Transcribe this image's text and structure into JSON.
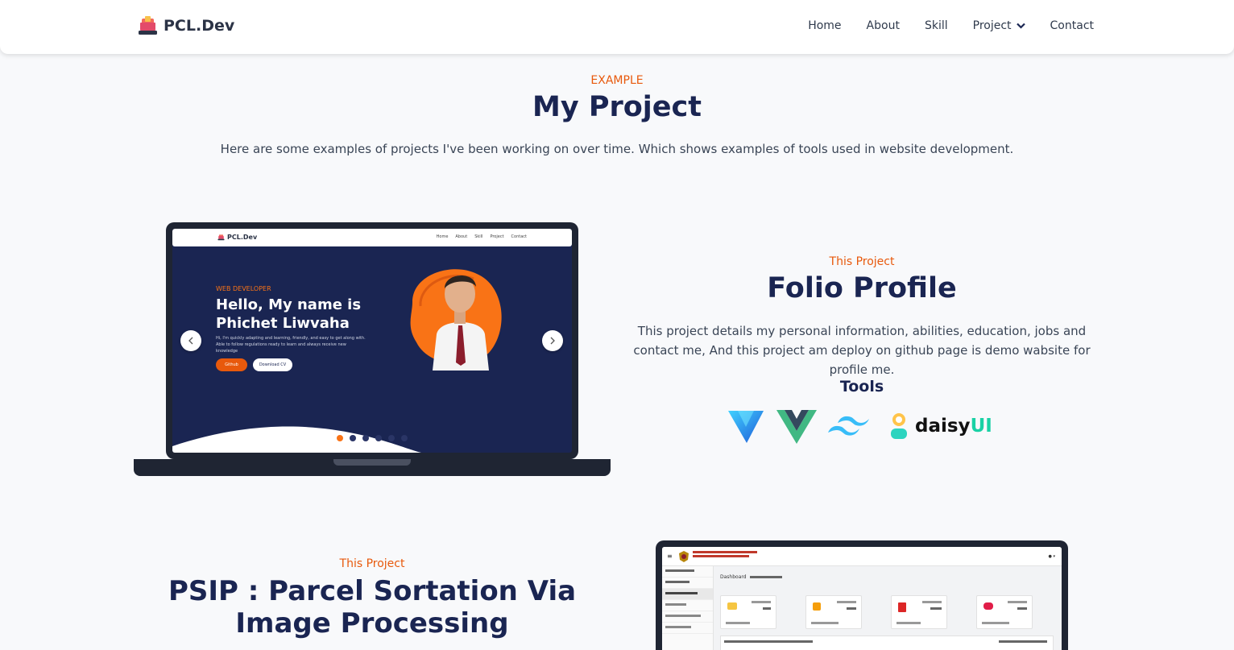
{
  "nav": {
    "brand": "PCL.Dev",
    "links": [
      "Home",
      "About",
      "Skill",
      "Project",
      "Contact"
    ]
  },
  "header": {
    "eyebrow": "EXAMPLE",
    "title": "My Project",
    "intro": "Here are some examples of projects I've been working on over time. Which shows examples of tools used in website development."
  },
  "project1": {
    "eyebrow": "This Project",
    "title": "Folio Profile",
    "description": "This project details my personal information, abilities, education, jobs and contact me, And this project am deploy on github page is demo wabsite for profile me.",
    "tools_heading": "Tools",
    "tools": [
      "vite-icon",
      "vue-icon",
      "tailwind-icon",
      "daisyui-icon"
    ],
    "daisy_label_1": "daisy",
    "daisy_label_2": "UI",
    "preview": {
      "brand": "PCL.Dev",
      "links": [
        "Home",
        "About",
        "Skill",
        "Project",
        "Contact"
      ],
      "eyebrow": "WEB DEVELOPER",
      "title": "Hello, My name is Phichet Liwvaha",
      "description": "Hi, I'm quickly adapting and learning, friendly, and easy to get along with. Able to follow regulations ready to learn and always receive new knowledge",
      "btn_github": "Github",
      "btn_cv": "Download CV"
    }
  },
  "project2": {
    "eyebrow": "This Project",
    "title": "PSIP : Parcel Sortation Via Image Processing",
    "preview": {
      "breadcrumb": "Dashboard"
    }
  },
  "colors": {
    "accent": "#e8590c",
    "navy": "#1a2552",
    "background": "#f8f9fb"
  }
}
